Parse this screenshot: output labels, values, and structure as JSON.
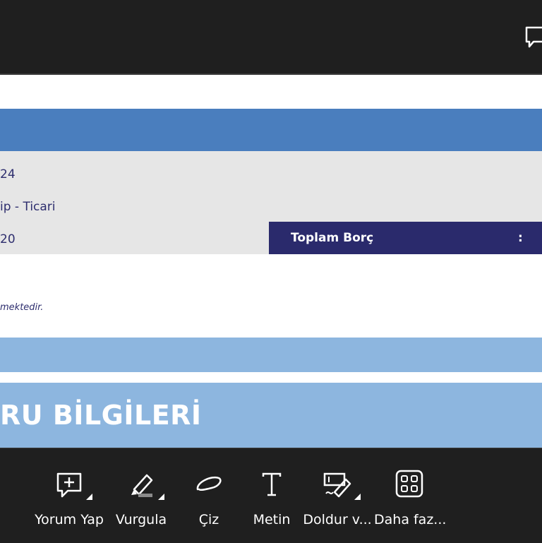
{
  "document": {
    "info_line_1": "24",
    "info_line_2": "ip - Ticari",
    "info_line_3": "20",
    "debt_label": "Toplam Borç",
    "debt_colon": ":",
    "note": "mektedir.",
    "section_title": "RU BİLGİLERİ"
  },
  "toolbar": {
    "items": [
      {
        "label": "Yorum Yap",
        "icon": "comment-add-icon"
      },
      {
        "label": "Vurgula",
        "icon": "highlighter-icon"
      },
      {
        "label": "Çiz",
        "icon": "draw-icon"
      },
      {
        "label": "Metin",
        "icon": "text-icon"
      },
      {
        "label": "Doldur v...",
        "icon": "fill-sign-icon"
      },
      {
        "label": "Daha faz...",
        "icon": "more-grid-icon"
      }
    ]
  },
  "colors": {
    "dark_bg": "#1f1f1f",
    "header_blue": "#4a7ebe",
    "light_blue": "#8db6df",
    "navy": "#2a2a6c",
    "grey_band": "#e6e6e6"
  }
}
